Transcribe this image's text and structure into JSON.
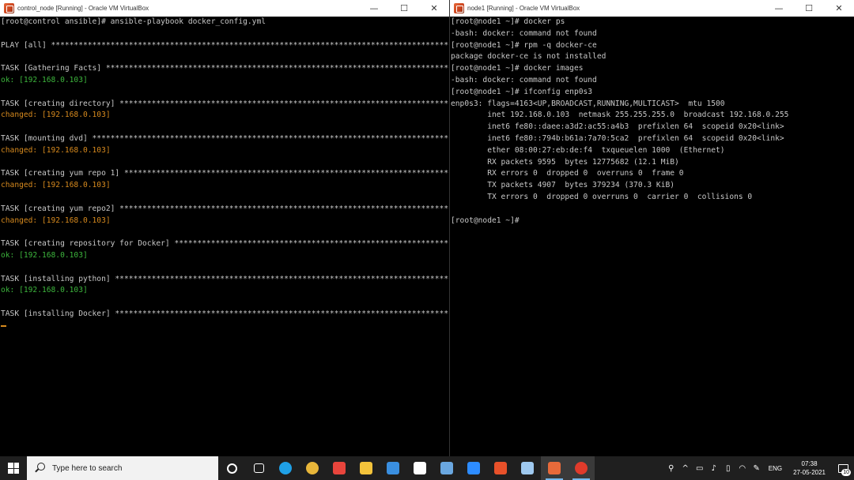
{
  "left_window": {
    "title": "control_node [Running] - Oracle VM VirtualBox",
    "buttons": {
      "minimize": "—",
      "maximize": "☐",
      "close": "✕"
    },
    "lines": [
      {
        "kind": "task",
        "text": "[root@control ansible]# ansible-playbook docker_config.yml"
      },
      {
        "kind": "task",
        "text": ""
      },
      {
        "kind": "task",
        "text": "PLAY [all] *************************************************************************************************************"
      },
      {
        "kind": "task",
        "text": ""
      },
      {
        "kind": "task",
        "text": "TASK [Gathering Facts] *************************************************************************************************"
      },
      {
        "kind": "ok",
        "text": "ok: [192.168.0.103]"
      },
      {
        "kind": "task",
        "text": ""
      },
      {
        "kind": "task",
        "text": "TASK [creating directory] **********************************************************************************************"
      },
      {
        "kind": "changed",
        "text": "changed: [192.168.0.103]"
      },
      {
        "kind": "task",
        "text": ""
      },
      {
        "kind": "task",
        "text": "TASK [mounting dvd] ****************************************************************************************************"
      },
      {
        "kind": "changed",
        "text": "changed: [192.168.0.103]"
      },
      {
        "kind": "task",
        "text": ""
      },
      {
        "kind": "task",
        "text": "TASK [creating yum repo 1] *********************************************************************************************"
      },
      {
        "kind": "changed",
        "text": "changed: [192.168.0.103]"
      },
      {
        "kind": "task",
        "text": ""
      },
      {
        "kind": "task",
        "text": "TASK [creating yum repo2] **********************************************************************************************"
      },
      {
        "kind": "changed",
        "text": "changed: [192.168.0.103]"
      },
      {
        "kind": "task",
        "text": ""
      },
      {
        "kind": "task",
        "text": "TASK [creating repository for Docker] **********************************************************************************"
      },
      {
        "kind": "ok",
        "text": "ok: [192.168.0.103]"
      },
      {
        "kind": "task",
        "text": ""
      },
      {
        "kind": "task",
        "text": "TASK [installing python] ***********************************************************************************************"
      },
      {
        "kind": "ok",
        "text": "ok: [192.168.0.103]"
      },
      {
        "kind": "task",
        "text": ""
      },
      {
        "kind": "task",
        "text": "TASK [installing Docker] ***********************************************************************************************"
      },
      {
        "kind": "task",
        "text": ""
      }
    ]
  },
  "right_window": {
    "title": "node1 [Running] - Oracle VM VirtualBox",
    "buttons": {
      "minimize": "—",
      "maximize": "☐",
      "close": "✕"
    },
    "lines": [
      "[root@node1 ~]# docker ps",
      "-bash: docker: command not found",
      "[root@node1 ~]# rpm -q docker-ce",
      "package docker-ce is not installed",
      "[root@node1 ~]# docker images",
      "-bash: docker: command not found",
      "[root@node1 ~]# ifconfig enp0s3",
      "enp0s3: flags=4163<UP,BROADCAST,RUNNING,MULTICAST>  mtu 1500",
      "        inet 192.168.0.103  netmask 255.255.255.0  broadcast 192.168.0.255",
      "        inet6 fe80::daee:a3d2:ac55:a4b3  prefixlen 64  scopeid 0x20<link>",
      "        inet6 fe80::794b:b61a:7a70:5ca2  prefixlen 64  scopeid 0x20<link>",
      "        ether 08:00:27:eb:de:f4  txqueuelen 1000  (Ethernet)",
      "        RX packets 9595  bytes 12775682 (12.1 MiB)",
      "        RX errors 0  dropped 0  overruns 0  frame 0",
      "        TX packets 4907  bytes 379234 (370.3 KiB)",
      "        TX errors 0  dropped 0 overruns 0  carrier 0  collisions 0",
      "",
      "[root@node1 ~]#"
    ]
  },
  "taskbar": {
    "search_placeholder": "Type here to search",
    "apps": [
      {
        "name": "task-view-icon",
        "color": "#ffffff",
        "active": false
      },
      {
        "name": "widgets-icon",
        "color": "#ffffff",
        "active": false
      },
      {
        "name": "edge-icon",
        "color": "#1fa0e6",
        "active": false
      },
      {
        "name": "chrome-icon",
        "color": "#e8b63a",
        "active": false
      },
      {
        "name": "store-gift-icon",
        "color": "#e8453c",
        "active": false
      },
      {
        "name": "file-explorer-icon",
        "color": "#f3c33b",
        "active": false
      },
      {
        "name": "mail-icon",
        "color": "#3a8fe0",
        "active": false
      },
      {
        "name": "store-bag-icon",
        "color": "#ffffff",
        "active": false
      },
      {
        "name": "remote-desktop-icon",
        "color": "#6aa7e0",
        "active": false
      },
      {
        "name": "zoom-icon",
        "color": "#2d8cff",
        "active": false
      },
      {
        "name": "office-icon",
        "color": "#e8512a",
        "active": false
      },
      {
        "name": "cube-icon",
        "color": "#9fc9ef",
        "active": false
      },
      {
        "name": "virtualbox-icon",
        "color": "#e86a3a",
        "active": true
      },
      {
        "name": "recorder-icon",
        "color": "#e03b2b",
        "active": true
      }
    ],
    "tray": {
      "language": "ENG",
      "time": "07:38",
      "date": "27-05-2021",
      "notifications": "10"
    }
  }
}
